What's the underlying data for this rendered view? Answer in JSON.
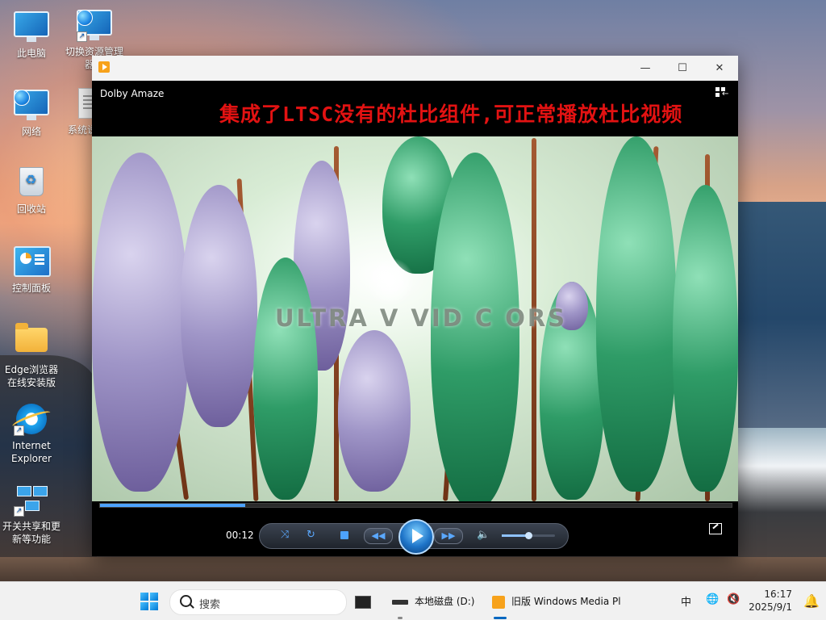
{
  "desktop": {
    "icons": [
      {
        "label": "此电脑",
        "icon": "computer-icon"
      },
      {
        "label": "切换资源管理器样",
        "icon": "explorer-switch-icon"
      },
      {
        "label": "网络",
        "icon": "network-icon"
      },
      {
        "label": "系统说",
        "icon": "document-icon"
      },
      {
        "label": "回收站",
        "icon": "recycle-bin-icon"
      },
      {
        "label": "控制面板",
        "icon": "control-panel-icon"
      },
      {
        "label": "Edge浏览器在线安装版",
        "icon": "folder-icon"
      },
      {
        "label": "Internet Explorer",
        "icon": "ie-icon"
      },
      {
        "label": "开关共享和更新等功能",
        "icon": "network-share-icon"
      }
    ]
  },
  "window": {
    "title_controls": {
      "minimize": "—",
      "maximize": "☐",
      "close": "✕"
    },
    "now_playing": "Dolby Amaze",
    "banner": "集成了LTSC没有的杜比组件,可正常播放杜比视频",
    "video_overlay_text": "ULTRA V VID C  ORS",
    "playback": {
      "time": "00:12",
      "progress": 0.23,
      "volume": 0.5
    },
    "colors": {
      "banner": "#e21212",
      "accent": "#4da3ff"
    }
  },
  "taskbar": {
    "search_placeholder": "搜索",
    "apps": [
      {
        "label": "本地磁盘 (D:)",
        "icon": "drive-icon"
      },
      {
        "label": "旧版 Windows Media Pl",
        "icon": "media-player-icon"
      }
    ],
    "ime": "中",
    "clock": {
      "time": "16:17",
      "date": "2025/9/1"
    }
  }
}
